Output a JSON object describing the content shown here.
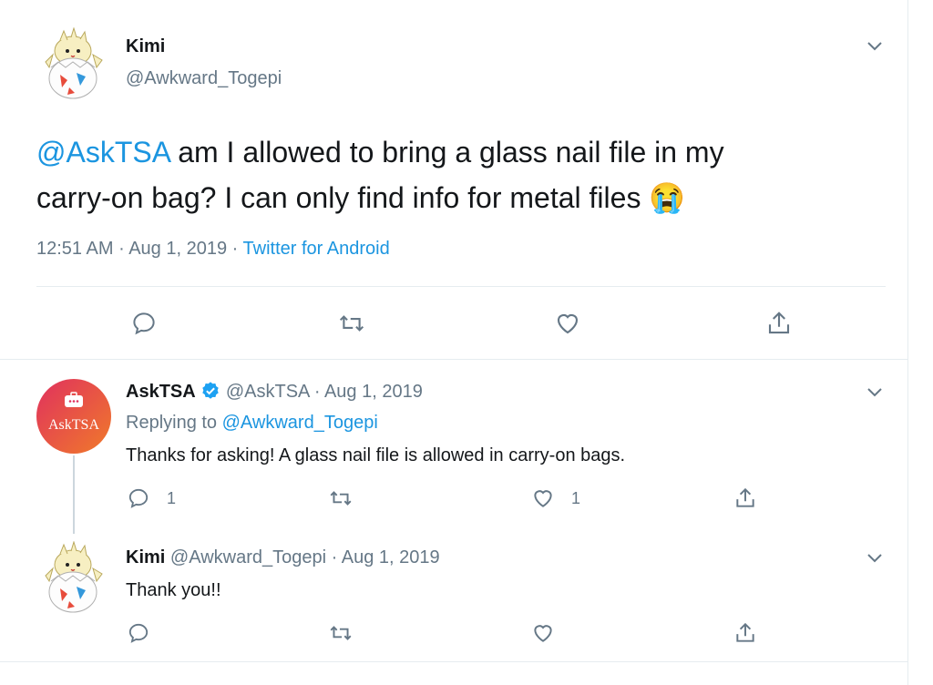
{
  "main_tweet": {
    "display_name": "Kimi",
    "handle": "@Awkward_Togepi",
    "mention": "@AskTSA",
    "text_line1": "am I allowed to bring a glass nail file in my",
    "text_line2": "carry-on bag? I can only find info for metal files",
    "emoji": "😭",
    "time": "12:51 AM",
    "sep": "·",
    "date": "Aug 1, 2019",
    "source_sep": "·",
    "source": "Twitter for Android"
  },
  "reply1": {
    "display_name": "AskTSA",
    "handle": "@AskTSA",
    "sep": "·",
    "date": "Aug 1, 2019",
    "replying_label": "Replying to",
    "replying_to": "@Awkward_Togepi",
    "text": "Thanks for asking! A glass nail file is allowed in carry-on bags.",
    "reply_count": "1",
    "like_count": "1",
    "avatar_text": "AskTSA"
  },
  "reply2": {
    "display_name": "Kimi",
    "handle": "@Awkward_Togepi",
    "sep": "·",
    "date": "Aug 1, 2019",
    "text": "Thank you!!"
  },
  "colors": {
    "link": "#1b95e0",
    "muted": "#657786",
    "verified": "#1da1f2",
    "tsa_gradient_start": "#e0315e",
    "tsa_gradient_end": "#f07a2a"
  }
}
